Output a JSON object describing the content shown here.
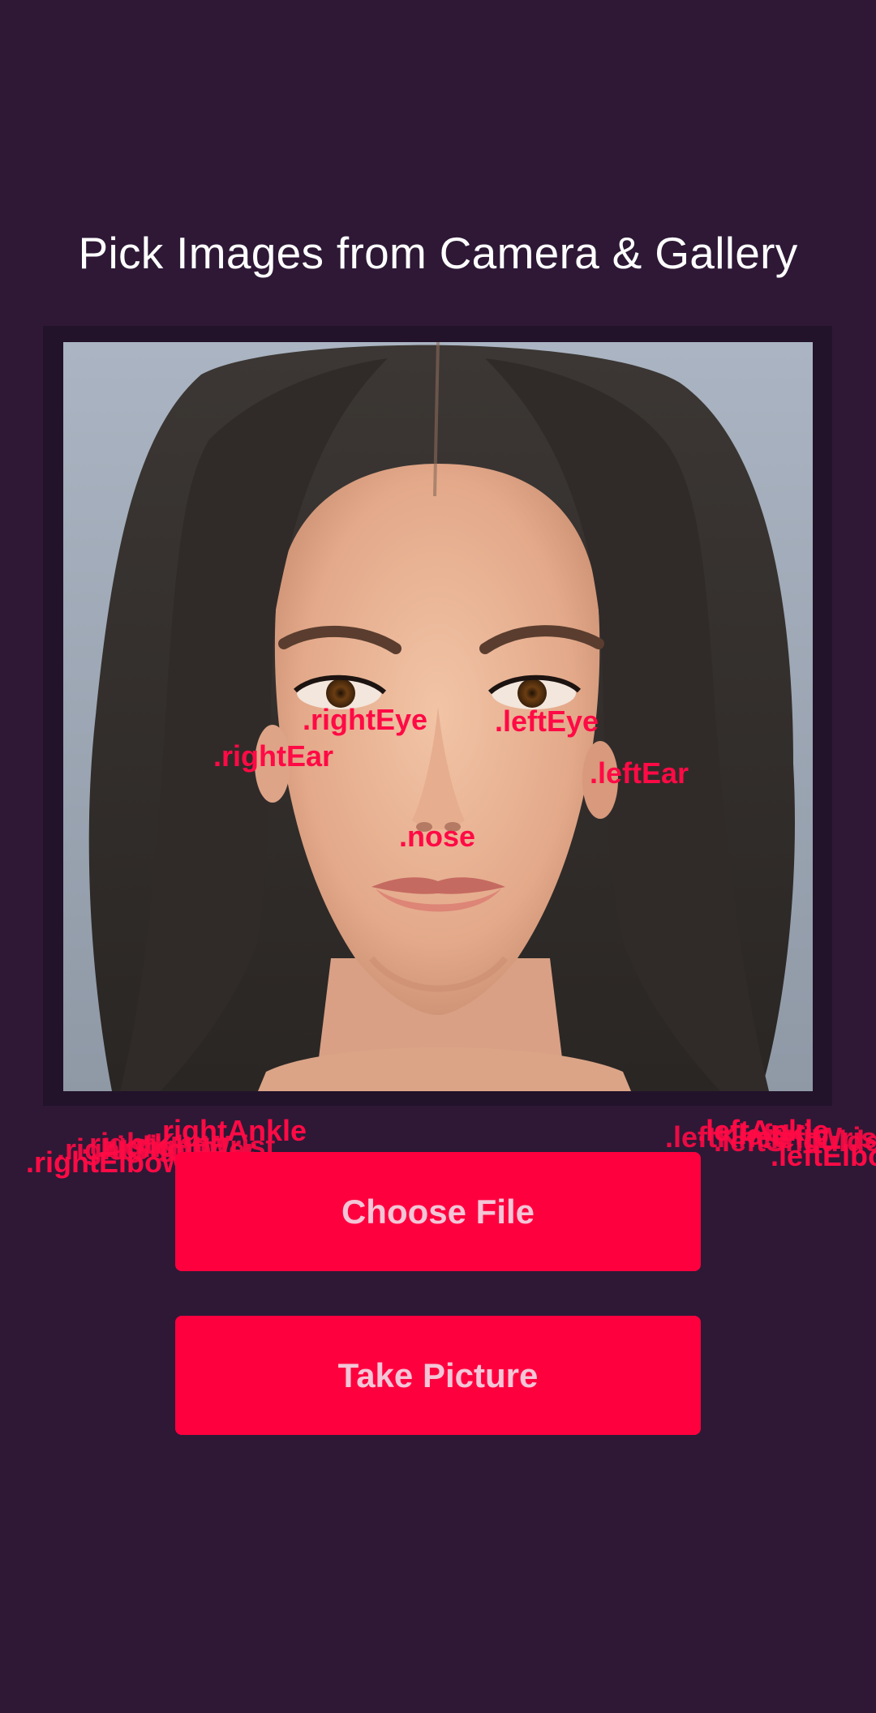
{
  "header": {
    "title": "Pick Images from Camera & Gallery"
  },
  "photo": {
    "subject": "portrait-photo"
  },
  "face_labels": {
    "right_eye": ".rightEye",
    "left_eye": ".leftEye",
    "right_ear": ".rightEar",
    "left_ear": ".leftEar",
    "nose": ".nose"
  },
  "stray_labels_left": {
    "right_ankle": ".rightAnkle",
    "right_elbow": ".rightElbow",
    "overlap_1": ".rightKnee",
    "overlap_2": ".rightHip",
    "overlap_3": ".rightShoulder",
    "overlap_4": ".rightWrist"
  },
  "stray_labels_right": {
    "left_ankle": ".leftAnkle",
    "left_elbow": ".leftElbow",
    "overlap_1": ".leftKnee",
    "overlap_2": ".leftHip",
    "overlap_3": ".leftShoulder",
    "overlap_4": ".leftWrist"
  },
  "buttons": {
    "choose_file": "Choose File",
    "take_picture": "Take Picture"
  },
  "colors": {
    "background": "#2e1836",
    "frame": "#22122a",
    "accent": "#ff003f",
    "label": "#ff0a45",
    "button_text": "#f3c5d6"
  }
}
